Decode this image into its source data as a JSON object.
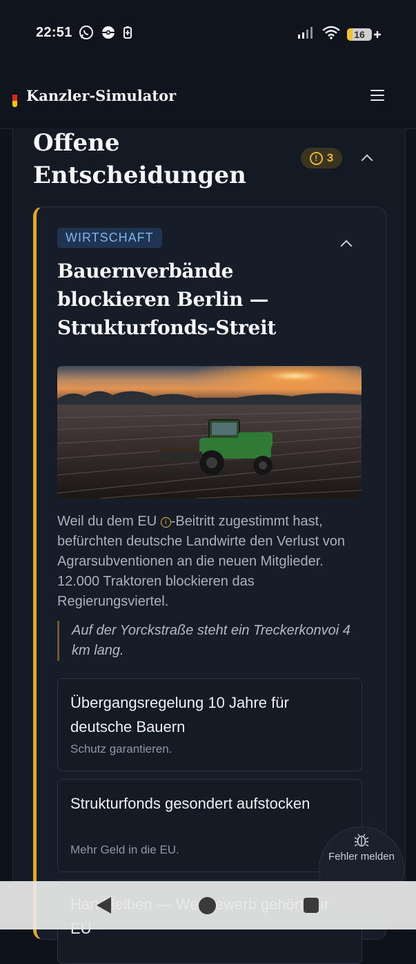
{
  "status_bar": {
    "time": "22:51",
    "left_icons": [
      "whatsapp-icon",
      "pokeball-icon",
      "battery-saver-icon"
    ],
    "right_icons": [
      "signal-icon",
      "wifi-icon",
      "battery-icon"
    ],
    "battery_level": "16"
  },
  "app_bar": {
    "title": "Kanzler-Simulator",
    "logo": "german-flag-icon",
    "menu_icon": "hamburger-menu-icon"
  },
  "section": {
    "title": "Offene Entscheidungen",
    "badge_count": "3",
    "badge_icon": "warning-icon",
    "badge_color": "#e8b53a",
    "collapse_icon": "chevron-up-icon"
  },
  "event": {
    "category": "WIRTSCHAFT",
    "accent_color": "#e0a827",
    "title": "Bauernverbände blockieren Berlin — Strukturfonds-Streit",
    "image_alt": "Traktor auf einem Feld bei Sonnenuntergang",
    "description_part1": "Weil du dem EU ",
    "description_part2": "-Beitritt zugestimmt hast, befürchten deutsche Landwirte den Verlust von Agrarsubventionen an die neuen Mitglieder. 12.000 Traktoren blockieren das Regierungsviertel.",
    "quote": "Auf der Yorckstraße steht ein Treckerkonvoi 4 km lang.",
    "options": [
      {
        "title": "Übergangsregelung 10 Jahre für deutsche Bauern",
        "description": "Schutz garantieren."
      },
      {
        "title": "Strukturfonds gesondert aufstocken",
        "description": "Mehr Geld in die EU."
      },
      {
        "title": "Hart bleiben — Wettbewerb gehört zur EU",
        "description": ""
      }
    ]
  },
  "fab": {
    "label": "Fehler melden",
    "icon": "bug-icon"
  },
  "nav_bar": {
    "buttons": [
      "back-icon",
      "home-icon",
      "recents-icon"
    ]
  }
}
